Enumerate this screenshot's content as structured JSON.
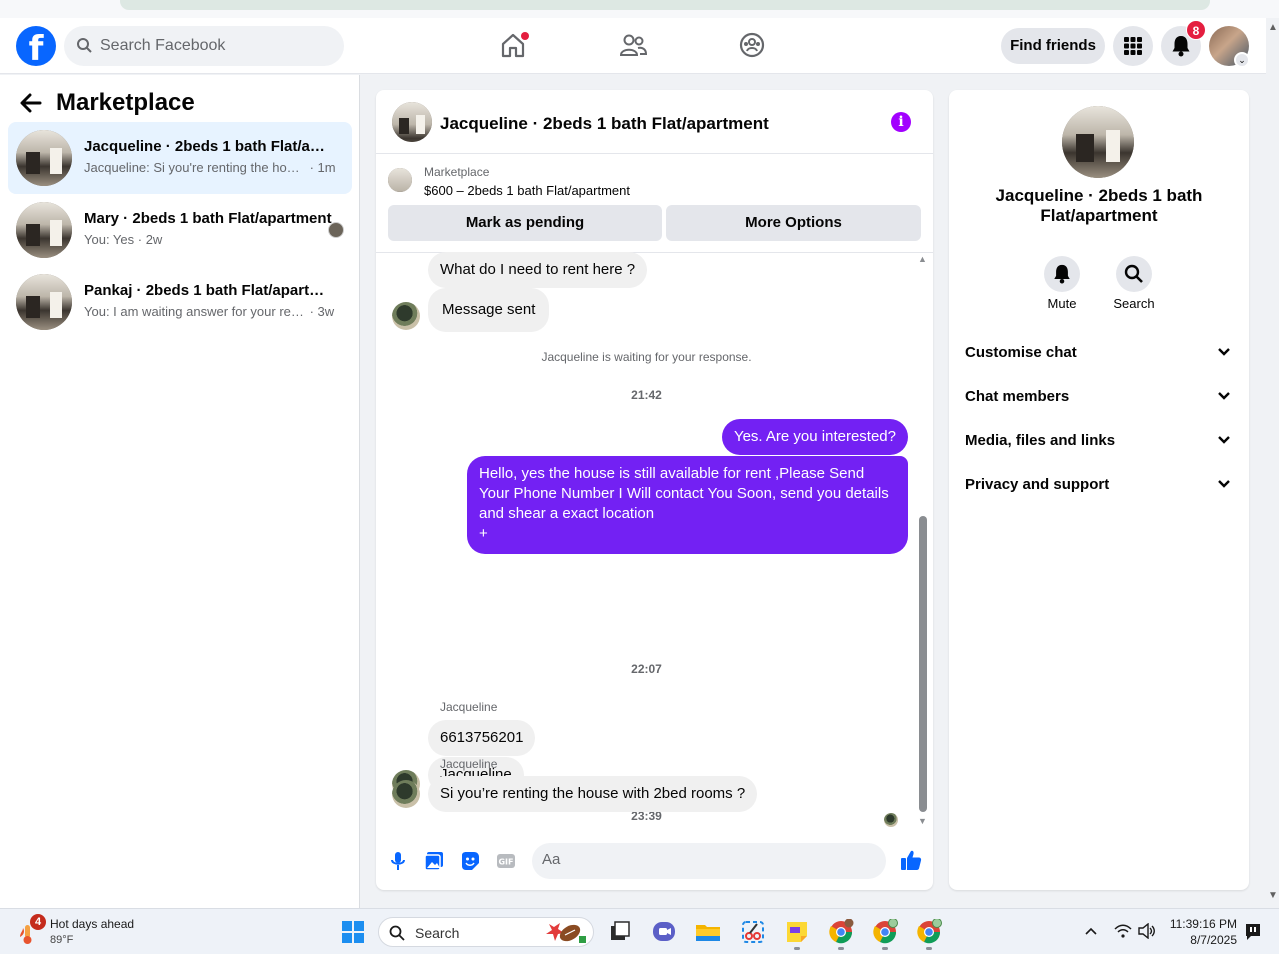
{
  "topnav": {
    "search_placeholder": "Search Facebook",
    "find_friends": "Find friends",
    "notification_count": "8"
  },
  "sidebar": {
    "title": "Marketplace",
    "conversations": [
      {
        "title": "Jacqueline · 2beds 1 bath Flat/apartment",
        "preview": "Jacqueline: Si you're renting the house with 2bed rooms ?",
        "time": " · 1m",
        "active": true
      },
      {
        "title": "Mary · 2beds 1 bath Flat/apartment",
        "preview": "You: Yes",
        "time": " · 2w",
        "active": false
      },
      {
        "title": "Pankaj · 2beds 1 bath Flat/apartment",
        "preview": "You: I am waiting answer for your response",
        "time": " · 3w",
        "active": false
      }
    ]
  },
  "chat": {
    "title": "Jacqueline · 2beds 1 bath Flat/apartment",
    "marketplace_label": "Marketplace",
    "listing": "$600 – 2beds 1 bath Flat/apartment",
    "mark_pending": "Mark as pending",
    "more_options": "More Options",
    "messages": {
      "m1": "What do I need to rent here ?",
      "m2": "Message sent",
      "system": "Jacqueline is waiting for your response.",
      "time1": "21:42",
      "m3": "Yes. Are you interested?",
      "m4": "Hello, yes the house is still available for rent ,Please Send Your Phone Number I Will contact You Soon, send you details and shear a exact location",
      "m4_plus": "+",
      "time2": "22:07",
      "sender1": "Jacqueline",
      "m5": "6613756201",
      "m6": "Jacqueline",
      "time3": "23:39",
      "sender2": "Jacqueline",
      "m7": "Si you’re renting the house with 2bed rooms ?"
    },
    "composer_placeholder": "Aa",
    "composer_icons": [
      "microphone-icon",
      "photo-icon",
      "sticker-icon",
      "gif-icon",
      "emoji-icon",
      "like-icon"
    ],
    "accent_color": "#7321f3"
  },
  "info_panel": {
    "title": "Jacqueline · 2beds 1 bath Flat/apartment",
    "mute": "Mute",
    "search": "Search",
    "sections": [
      "Customise chat",
      "Chat members",
      "Media, files and links",
      "Privacy and support"
    ]
  },
  "taskbar": {
    "weather_badge": "4",
    "weather_title": "Hot days ahead",
    "weather_temp": "89°F",
    "search": "Search",
    "time": "11:39:16 PM",
    "date": "8/7/2025"
  }
}
